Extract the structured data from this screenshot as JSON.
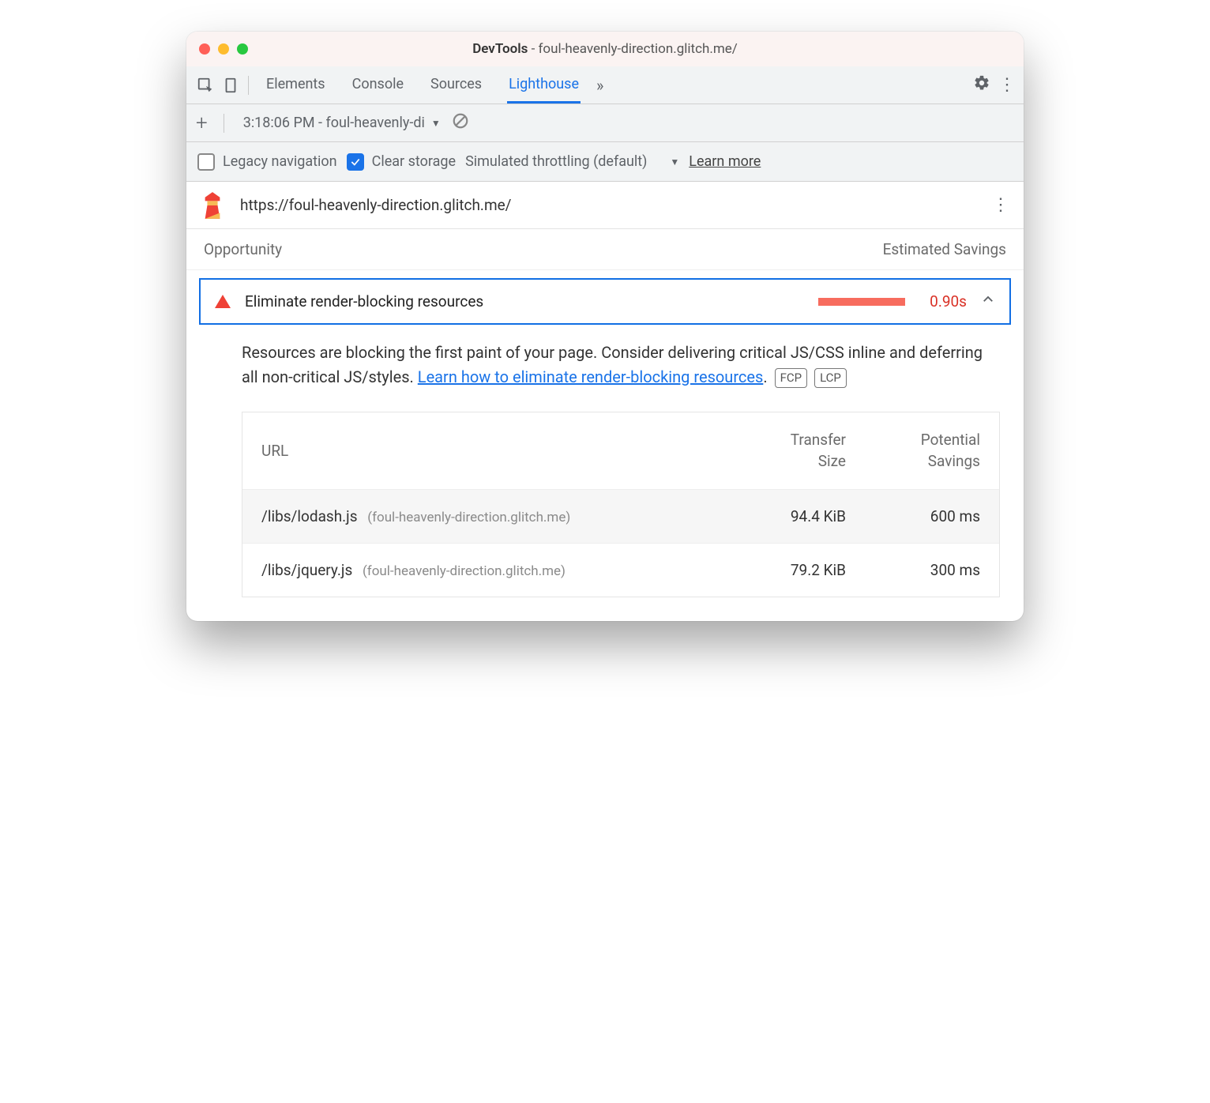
{
  "window": {
    "title_prefix": "DevTools",
    "title_target": "foul-heavenly-direction.glitch.me/"
  },
  "tabs": {
    "items": [
      "Elements",
      "Console",
      "Sources",
      "Lighthouse"
    ],
    "active": "Lighthouse"
  },
  "subtoolbar": {
    "report_dropdown": "3:18:06 PM - foul-heavenly-di"
  },
  "options": {
    "legacy_nav": {
      "label": "Legacy navigation",
      "checked": false
    },
    "clear_storage": {
      "label": "Clear storage",
      "checked": true
    },
    "throttling_label": "Simulated throttling (default)",
    "learn_more": "Learn more"
  },
  "url_bar": {
    "url": "https://foul-heavenly-direction.glitch.me/"
  },
  "opportunity": {
    "header_left": "Opportunity",
    "header_right": "Estimated Savings",
    "audit": {
      "title": "Eliminate render-blocking resources",
      "savings": "0.90s"
    },
    "description": {
      "text_before": "Resources are blocking the first paint of your page. Consider delivering critical JS/CSS inline and deferring all non-critical JS/styles. ",
      "link_text": "Learn how to eliminate render-blocking resources",
      "text_after": ".",
      "tags": [
        "FCP",
        "LCP"
      ]
    },
    "table": {
      "headers": {
        "url": "URL",
        "size_l1": "Transfer",
        "size_l2": "Size",
        "sav_l1": "Potential",
        "sav_l2": "Savings"
      },
      "rows": [
        {
          "path": "/libs/lodash.js",
          "host": "(foul-heavenly-direction.glitch.me)",
          "size": "94.4 KiB",
          "savings": "600 ms"
        },
        {
          "path": "/libs/jquery.js",
          "host": "(foul-heavenly-direction.glitch.me)",
          "size": "79.2 KiB",
          "savings": "300 ms"
        }
      ]
    }
  }
}
